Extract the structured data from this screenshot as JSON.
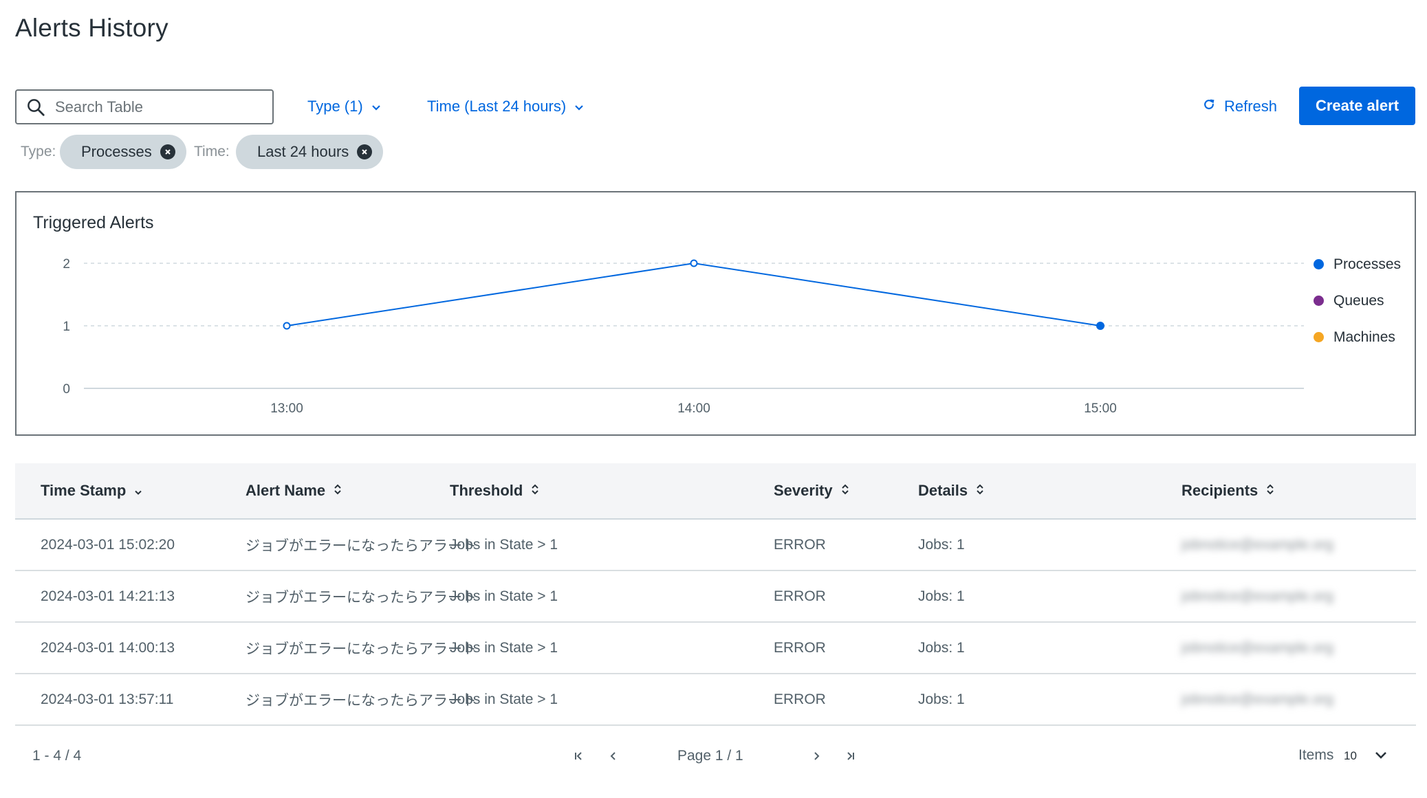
{
  "page": {
    "title": "Alerts History"
  },
  "toolbar": {
    "search_placeholder": "Search Table",
    "type_filter": "Type (1)",
    "time_filter": "Time (Last 24 hours)",
    "refresh_label": "Refresh",
    "create_label": "Create alert"
  },
  "chips": [
    {
      "label": "Type:",
      "value": "Processes"
    },
    {
      "label": "Time:",
      "value": "Last 24 hours"
    }
  ],
  "colors": {
    "accent": "#0067df",
    "processes": "#0067df",
    "queues": "#7b2d8e",
    "machines": "#f5a623"
  },
  "chart_data": {
    "type": "line",
    "title": "Triggered Alerts",
    "x": [
      "13:00",
      "14:00",
      "15:00"
    ],
    "series": [
      {
        "name": "Processes",
        "values": [
          1,
          2,
          1
        ]
      }
    ],
    "legend": [
      "Processes",
      "Queues",
      "Machines"
    ],
    "yticks": [
      0,
      1,
      2
    ],
    "ylim": [
      0,
      2
    ],
    "grid": true,
    "legend_position": "right"
  },
  "table": {
    "columns": [
      "Time Stamp",
      "Alert Name",
      "Threshold",
      "Severity",
      "Details",
      "Recipients"
    ],
    "rows": [
      [
        "2024-03-01 15:02:20",
        "ジョブがエラーになったらアラート",
        "Jobs in State > 1",
        "ERROR",
        "Jobs: 1",
        "jobnotice@example.org"
      ],
      [
        "2024-03-01 14:21:13",
        "ジョブがエラーになったらアラート",
        "Jobs in State > 1",
        "ERROR",
        "Jobs: 1",
        "jobnotice@example.org"
      ],
      [
        "2024-03-01 14:00:13",
        "ジョブがエラーになったらアラート",
        "Jobs in State > 1",
        "ERROR",
        "Jobs: 1",
        "jobnotice@example.org"
      ],
      [
        "2024-03-01 13:57:11",
        "ジョブがエラーになったらアラート",
        "Jobs in State > 1",
        "ERROR",
        "Jobs: 1",
        "jobnotice@example.org"
      ]
    ]
  },
  "pagination": {
    "range": "1 - 4 / 4",
    "page_info": "Page 1 / 1",
    "items_label": "Items",
    "items_value": "10"
  }
}
